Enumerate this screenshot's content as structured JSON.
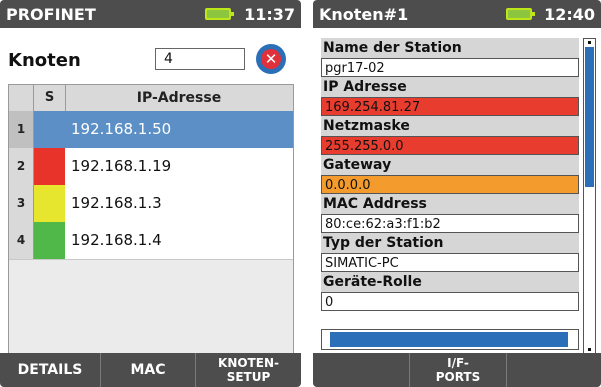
{
  "left_screen": {
    "title": "PROFINET",
    "time": "11:37",
    "knoten_label": "Knoten",
    "knoten_value": "4",
    "table": {
      "headers": {
        "status": "S",
        "ip": "IP-Adresse"
      },
      "rows": [
        {
          "num": "1",
          "status_color": "#5b8fc5",
          "ip": "192.168.1.50",
          "selected": true
        },
        {
          "num": "2",
          "status_color": "#e8332a",
          "ip": "192.168.1.19",
          "selected": false
        },
        {
          "num": "3",
          "status_color": "#e6e62e",
          "ip": "192.168.1.3",
          "selected": false
        },
        {
          "num": "4",
          "status_color": "#4fb848",
          "ip": "192.168.1.4",
          "selected": false
        }
      ]
    },
    "softkeys": {
      "details": "DETAILS",
      "mac": "MAC",
      "knoten_setup_line1": "KNOTEN-",
      "knoten_setup_line2": "SETUP"
    }
  },
  "right_screen": {
    "title": "Knoten#1",
    "time": "12:40",
    "fields": {
      "station_name": {
        "label": "Name der Station",
        "value": "pgr17-02"
      },
      "ip_address": {
        "label": "IP Adresse",
        "value": "169.254.81.27"
      },
      "netmask": {
        "label": "Netzmaske",
        "value": "255.255.0.0"
      },
      "gateway": {
        "label": "Gateway",
        "value": "0.0.0.0"
      },
      "mac_address": {
        "label": "MAC Address",
        "value": "80:ce:62:a3:f1:b2"
      },
      "station_type": {
        "label": "Typ der Station",
        "value": "SIMATIC-PC"
      },
      "device_role": {
        "label": "Geräte-Rolle",
        "value": "0"
      }
    },
    "softkeys": {
      "if_ports_line1": "I/F-",
      "if_ports_line2": "PORTS"
    }
  },
  "colors": {
    "titlebar": "#4d4d4d",
    "battery": "#8cc63f",
    "error_field": "#e83c2f",
    "warning_field": "#f39b2c",
    "accent_blue": "#2b6fb8"
  }
}
